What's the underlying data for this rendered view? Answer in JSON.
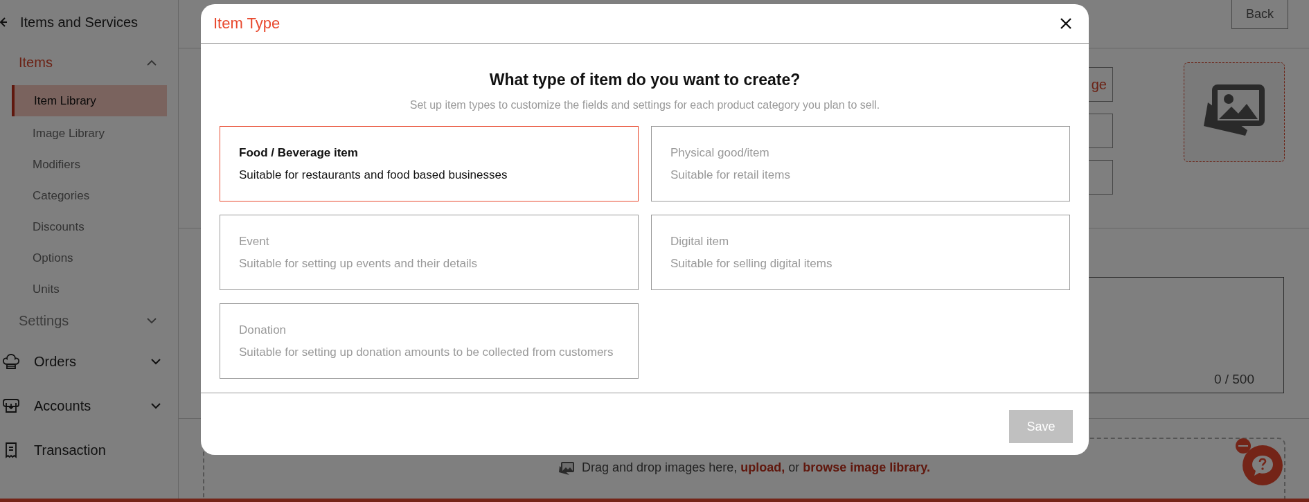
{
  "sidebar": {
    "title": "Items and Services",
    "groups": [
      {
        "label": "Items",
        "expanded": true,
        "items": [
          {
            "label": "Item Library",
            "selected": true
          },
          {
            "label": "Image Library",
            "selected": false
          },
          {
            "label": "Modifiers",
            "selected": false
          },
          {
            "label": "Categories",
            "selected": false
          },
          {
            "label": "Discounts",
            "selected": false
          },
          {
            "label": "Options",
            "selected": false
          },
          {
            "label": "Units",
            "selected": false
          }
        ]
      },
      {
        "label": "Settings",
        "expanded": false
      }
    ],
    "nav": [
      {
        "label": "Orders",
        "expanded": false
      },
      {
        "label": "Accounts",
        "expanded": false
      },
      {
        "label": "Transaction"
      }
    ]
  },
  "page": {
    "back_button": "Back",
    "image_button": "ge",
    "counter": "0 / 500",
    "dropzone": {
      "text": "Drag and drop images here,",
      "upload_link": "upload,",
      "middle": "or",
      "library_link": "browse image library."
    }
  },
  "modal": {
    "title": "Item Type",
    "question": "What type of item do you want to create?",
    "subtitle": "Set up item types to customize the fields and settings for each product category you plan to sell.",
    "options": [
      {
        "title": "Food / Beverage item",
        "description": "Suitable for restaurants and food based businesses",
        "selected": true
      },
      {
        "title": "Physical good/item",
        "description": "Suitable for retail items",
        "selected": false
      },
      {
        "title": "Event",
        "description": "Suitable for setting up events and their details",
        "selected": false
      },
      {
        "title": "Digital item",
        "description": "Suitable for selling digital items",
        "selected": false
      },
      {
        "title": "Donation",
        "description": "Suitable for setting up donation amounts to be collected from customers",
        "selected": false
      }
    ],
    "save_button": {
      "label": "Save",
      "disabled": true
    }
  }
}
